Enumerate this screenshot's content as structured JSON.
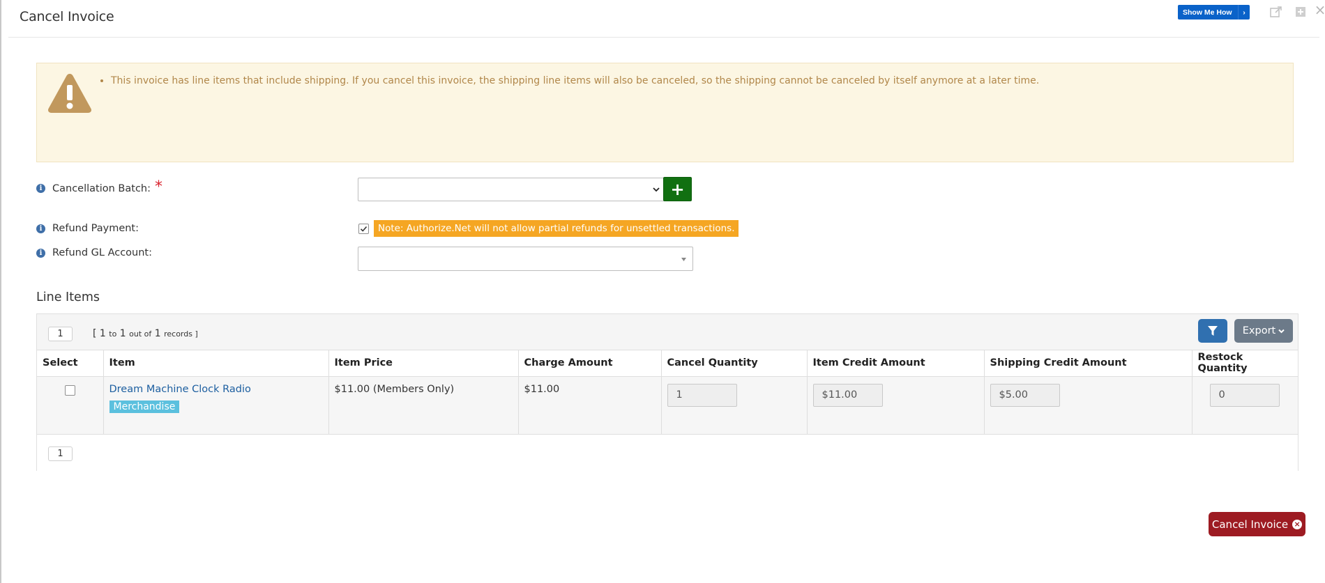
{
  "dialog": {
    "title": "Cancel Invoice",
    "show_me_how_label": "Show Me How",
    "chevron_glyph": "›",
    "header_icons": [
      "external-link-icon",
      "plus-square-icon",
      "close-icon"
    ],
    "close_glyph": "×"
  },
  "alert": {
    "icon": "warning-triangle-icon",
    "messages": [
      "This invoice has line items that include shipping. If you cancel this invoice, the shipping line items will also be canceled, so the shipping cannot be canceled by itself anymore at a later time."
    ]
  },
  "form": {
    "cancellation_batch": {
      "label": "Cancellation Batch:",
      "required_mark": "*",
      "value": "",
      "add_glyph": "+"
    },
    "refund_payment": {
      "label": "Refund Payment:",
      "checked": true,
      "note": "Note: Authorize.Net will not allow partial refunds for unsettled transactions."
    },
    "refund_gl_account": {
      "label": "Refund GL Account:",
      "value": ""
    },
    "info_glyph": "i"
  },
  "line_items": {
    "title": "Line Items",
    "pager_top": "1",
    "pager_bottom": "1",
    "records": {
      "open": "[ 1",
      "to_word": "to",
      "to": "1",
      "out_of_word": "out of",
      "total": "1",
      "records_word": "records ]"
    },
    "export_label": "Export",
    "columns": [
      "Select",
      "Item",
      "Item Price",
      "Charge Amount",
      "Cancel Quantity",
      "Item Credit Amount",
      "Shipping Credit Amount",
      "Restock Quantity"
    ],
    "rows": [
      {
        "selected": false,
        "item": "Dream Machine Clock Radio",
        "category": "Merchandise",
        "item_price": "$11.00 (Members Only)",
        "charge_amount": "$11.00",
        "cancel_quantity": "1",
        "item_credit_amount": "$11.00",
        "shipping_credit_amount": "$5.00",
        "restock_quantity": "0"
      }
    ]
  },
  "actions": {
    "cancel_invoice_label": "Cancel Invoice",
    "cancel_glyph": "×"
  },
  "colors": {
    "primary_blue": "#0a62c9",
    "alert_bg": "#fcf6e3",
    "alert_text": "#b1874a",
    "note_bg": "#f5a623",
    "add_green": "#117011",
    "danger": "#9d1b22",
    "tag_blue": "#5bc0de"
  }
}
